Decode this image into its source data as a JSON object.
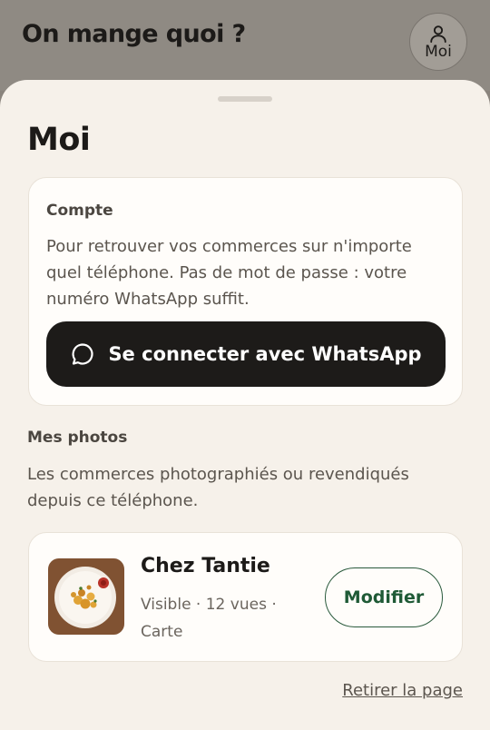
{
  "header": {
    "title": "On mange quoi ?",
    "me_label": "Moi"
  },
  "sheet": {
    "title": "Moi"
  },
  "account": {
    "label": "Compte",
    "description": "Pour retrouver vos commerces sur n'importe quel téléphone. Pas de mot de passe : votre numéro WhatsApp suffit.",
    "connect_label": "Se connecter avec WhatsApp"
  },
  "photos": {
    "label": "Mes photos",
    "description": "Les commerces photographiés ou revendiqués depuis ce téléphone.",
    "items": [
      {
        "name": "Chez Tantie",
        "meta": "Visible · 12 vues · Carte",
        "edit_label": "Modifier"
      }
    ]
  },
  "remove_link": "Retirer la page",
  "colors": {
    "accent": "#1f5a36",
    "button_dark": "#1d1b19",
    "sheet_bg": "#f6f1ea"
  }
}
